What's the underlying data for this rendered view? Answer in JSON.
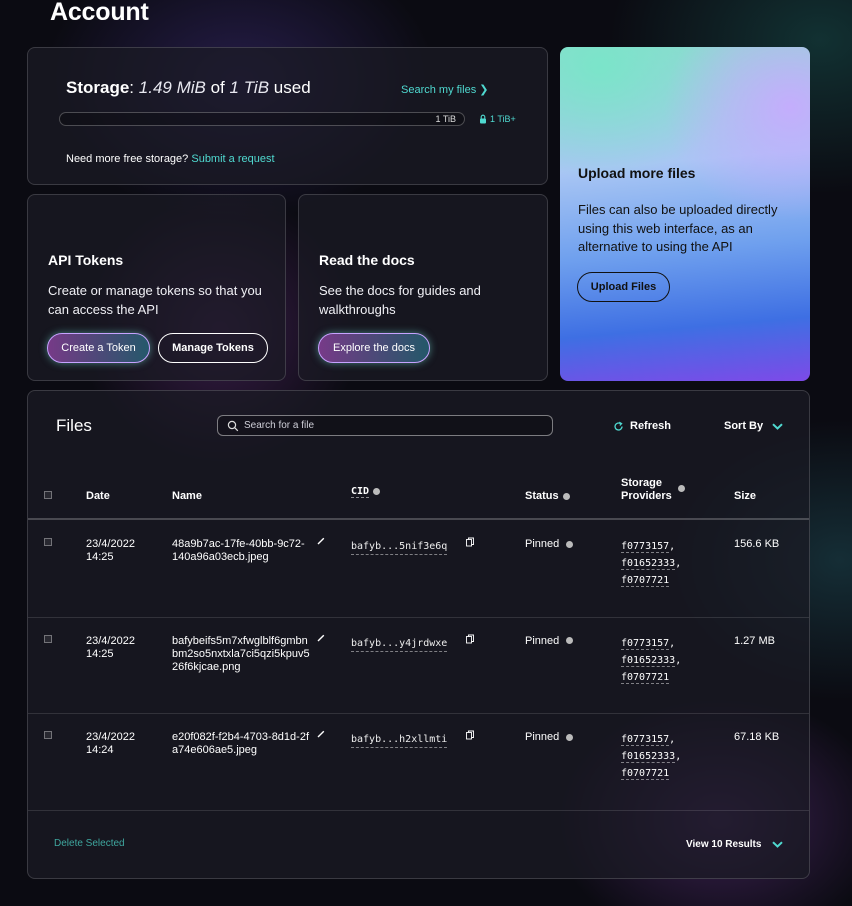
{
  "page": {
    "title": "Account"
  },
  "storage": {
    "label": "Storage",
    "colon": ":",
    "used": "1.49 MiB",
    "of": "of",
    "total": "1 TiB",
    "used_suffix": "used",
    "used_fraction": 1.4e-06,
    "search_link": "Search my files ❯",
    "bar_max_label": "1 TiB",
    "next_tier_label": "1 TiB+",
    "more_prompt": "Need more free storage?",
    "request_link": "Submit a request"
  },
  "upload": {
    "title": "Upload more files",
    "description": "Files can also be uploaded directly using this web interface, as an alternative to using the API",
    "button": "Upload Files"
  },
  "api_tokens": {
    "title": "API Tokens",
    "description": "Create or manage tokens so that you can access the API",
    "create_button": "Create a Token",
    "manage_button": "Manage Tokens"
  },
  "docs": {
    "title": "Read the docs",
    "description": "See the docs for guides and walkthroughs",
    "button": "Explore the docs"
  },
  "files": {
    "title": "Files",
    "search_placeholder": "Search for a file",
    "refresh_label": "Refresh",
    "sort_label": "Sort By",
    "columns": {
      "date": "Date",
      "name": "Name",
      "cid": "CID",
      "status": "Status",
      "storage_providers_line1": "Storage",
      "storage_providers_line2": "Providers",
      "size": "Size"
    },
    "rows": [
      {
        "date_line1": "23/4/2022",
        "date_line2": "14:25",
        "name": "48a9b7ac-17fe-40bb-9c72-140a96a03ecb.jpeg",
        "cid": "bafyb...5nif3e6q",
        "status": "Pinned",
        "providers": [
          "f0773157",
          "f01652333",
          "f0707721"
        ],
        "size": "156.6 KB"
      },
      {
        "date_line1": "23/4/2022",
        "date_line2": "14:25",
        "name": "bafybeifs5m7xfwglblf6gmbnbm2so5nxtxla7ci5qzi5kpuv526f6kjcae.png",
        "cid": "bafyb...y4jrdwxe",
        "status": "Pinned",
        "providers": [
          "f0773157",
          "f01652333",
          "f0707721"
        ],
        "size": "1.27 MB"
      },
      {
        "date_line1": "23/4/2022",
        "date_line2": "14:24",
        "name": "e20f082f-f2b4-4703-8d1d-2fa74e606ae5.jpeg",
        "cid": "bafyb...h2xllmti",
        "status": "Pinned",
        "providers": [
          "f0773157",
          "f01652333",
          "f0707721"
        ],
        "size": "67.18 KB"
      }
    ],
    "delete_selected": "Delete Selected",
    "view_results": "View 10 Results"
  },
  "icons": {
    "search": "search-icon",
    "refresh": "refresh-icon",
    "chevron": "chevron-down-icon",
    "lock": "lock-icon",
    "edit": "pencil-icon",
    "copy": "copy-icon",
    "info": "info-icon"
  },
  "colors": {
    "accent": "#4fd9d0",
    "background": "#0b0b12",
    "delete": "#3fa79f"
  }
}
